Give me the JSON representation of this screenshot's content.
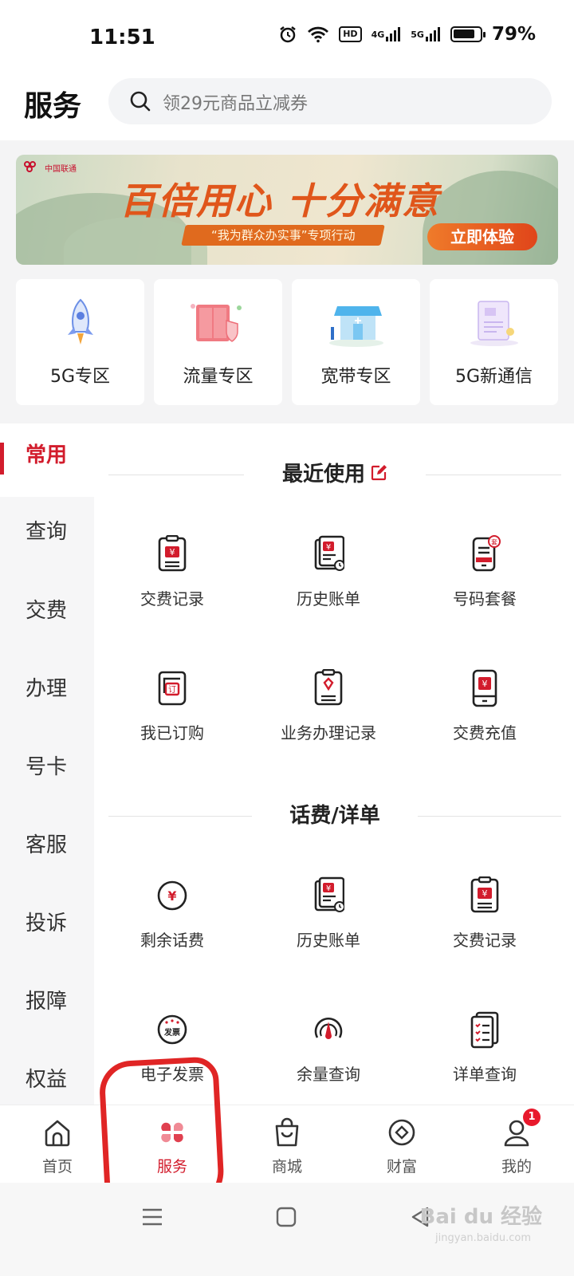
{
  "status_bar": {
    "time": "11:51",
    "battery_pct": "79%",
    "hd_label": "HD",
    "net1": "4G",
    "net2": "5G"
  },
  "header": {
    "title": "服务",
    "search_placeholder": "领29元商品立减券"
  },
  "banner": {
    "logo_text": "中国联通",
    "title": "百倍用心 十分满意",
    "ribbon": "“我为群众办实事”专项行动",
    "cta": "立即体验"
  },
  "zones": [
    {
      "label": "5G专区",
      "icon": "rocket-icon"
    },
    {
      "label": "流量专区",
      "icon": "traffic-icon"
    },
    {
      "label": "宽带专区",
      "icon": "broadband-icon"
    },
    {
      "label": "5G新通信",
      "icon": "new-messaging-icon"
    }
  ],
  "sidebar": {
    "items": [
      "常用",
      "查询",
      "交费",
      "办理",
      "号卡",
      "客服",
      "投诉",
      "报障",
      "权益"
    ],
    "active": "常用"
  },
  "sections": [
    {
      "title": "最近使用",
      "items": [
        {
          "label": "交费记录",
          "icon": "payment-record-icon"
        },
        {
          "label": "历史账单",
          "icon": "history-bill-icon"
        },
        {
          "label": "号码套餐",
          "icon": "number-plan-icon"
        },
        {
          "label": "我已订购",
          "icon": "subscribed-icon"
        },
        {
          "label": "业务办理记录",
          "icon": "business-record-icon"
        },
        {
          "label": "交费充值",
          "icon": "recharge-icon"
        }
      ]
    },
    {
      "title": "话费/详单",
      "items": [
        {
          "label": "剩余话费",
          "icon": "balance-icon"
        },
        {
          "label": "历史账单",
          "icon": "history-bill-icon"
        },
        {
          "label": "交费记录",
          "icon": "payment-record-icon"
        },
        {
          "label": "电子发票",
          "icon": "invoice-icon"
        },
        {
          "label": "余量查询",
          "icon": "remaining-icon"
        },
        {
          "label": "详单查询",
          "icon": "detail-list-icon"
        }
      ]
    }
  ],
  "bottom_nav": [
    {
      "label": "首页",
      "icon": "home-icon"
    },
    {
      "label": "服务",
      "icon": "service-icon",
      "active": true
    },
    {
      "label": "商城",
      "icon": "shop-bag-icon"
    },
    {
      "label": "财富",
      "icon": "wealth-icon"
    },
    {
      "label": "我的",
      "icon": "profile-icon",
      "badge": "1"
    }
  ],
  "watermark": {
    "brand": "Bai du 经验",
    "url": "jingyan.baidu.com"
  },
  "colors": {
    "accent": "#d21c2c",
    "banner_orange": "#e0561b"
  }
}
